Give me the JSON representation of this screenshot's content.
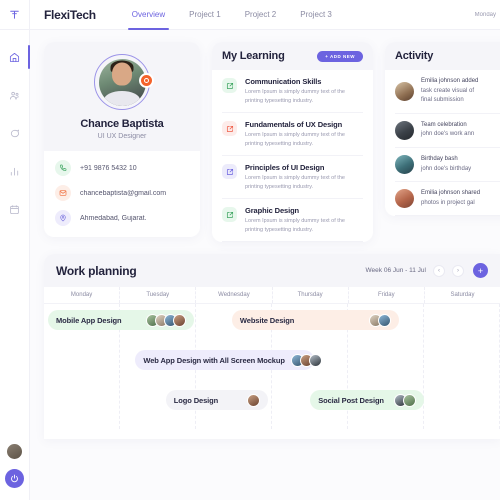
{
  "sidebar": {
    "logo_icon": "flexitech-t-logo-icon",
    "items": [
      {
        "icon": "home-icon",
        "name": "home",
        "active": true
      },
      {
        "icon": "users-icon",
        "name": "team",
        "active": false
      },
      {
        "icon": "chat-icon",
        "name": "messages",
        "active": false
      },
      {
        "icon": "chart-icon",
        "name": "analytics",
        "active": false
      },
      {
        "icon": "calendar-icon",
        "name": "calendar",
        "active": false
      }
    ],
    "bottom": {
      "avatar": "user-avatar",
      "power_icon": "power-icon"
    }
  },
  "header": {
    "brand": "FlexiTech",
    "tabs": [
      {
        "label": "Overview",
        "active": true
      },
      {
        "label": "Project 1",
        "active": false
      },
      {
        "label": "Project 2",
        "active": false
      },
      {
        "label": "Project 3",
        "active": false
      }
    ],
    "date_text": "Monday"
  },
  "profile": {
    "name": "Chance Baptista",
    "role": "UI UX Designer",
    "badge_icon": "verified-badge-icon",
    "rows": [
      {
        "icon": "phone-icon",
        "color": "green",
        "value": "+91 9876 5432 10"
      },
      {
        "icon": "mail-icon",
        "color": "orange",
        "value": "chancebaptista@gmail.com"
      },
      {
        "icon": "location-icon",
        "color": "purple",
        "value": "Ahmedabad, Gujarat."
      }
    ]
  },
  "learning": {
    "title": "My Learning",
    "add_button": "+ ADD NEW",
    "items": [
      {
        "name": "Communication Skills",
        "desc": "Lorem Ipsum is simply dummy text of the printing typesetting industry.",
        "color": "green"
      },
      {
        "name": "Fundamentals of UX Design",
        "desc": "Lorem Ipsum is simply dummy text of the printing typesetting industry.",
        "color": "red"
      },
      {
        "name": "Principles of UI Design",
        "desc": "Lorem Ipsum is simply dummy text of the printing typesetting industry.",
        "color": "purple"
      },
      {
        "name": "Graphic Design",
        "desc": "Lorem Ipsum is simply dummy text of the printing typesetting industry.",
        "color": "green"
      }
    ]
  },
  "activity": {
    "title": "Activity",
    "items": [
      {
        "line1": "Emilia johnson added",
        "line2": "task create visual of",
        "line3": "final submission"
      },
      {
        "line1": "Team celebration",
        "line2": "john doe's work ann",
        "line3": ""
      },
      {
        "line1": "Birthday bash",
        "line2": "john doe's birthday",
        "line3": ""
      },
      {
        "line1": "Emilia johnson shared",
        "line2": "photos in project gal",
        "line3": ""
      }
    ]
  },
  "planning": {
    "title": "Work planning",
    "week_label": "Week 06 Jun - 11 Jul",
    "prev_icon": "chevron-left-icon",
    "next_icon": "chevron-right-icon",
    "add_icon": "plus-icon",
    "days": [
      "Monday",
      "Tuesday",
      "Wednesday",
      "Thursday",
      "Friday",
      "Saturday"
    ],
    "tasks": [
      {
        "label": "Mobile App Design",
        "color": "#e5f7e8",
        "avatars": 4,
        "row": 0,
        "start": 0.0,
        "span": 2.02
      },
      {
        "label": "Website Design",
        "color": "#fdeee6",
        "avatars": 2,
        "row": 0,
        "start": 2.42,
        "span": 2.3
      },
      {
        "label": "Web App Design with All Screen Mockup",
        "color": "#eeecfc",
        "avatars": 3,
        "row": 1,
        "start": 1.15,
        "span": 2.45
      },
      {
        "label": "Logo Design",
        "color": "#f3f3f7",
        "avatars": 1,
        "row": 2,
        "start": 1.55,
        "span": 1.45
      },
      {
        "label": "Social Post Design",
        "color": "#e5f7e8",
        "avatars": 2,
        "row": 2,
        "start": 3.45,
        "span": 1.6
      }
    ]
  },
  "colors": {
    "accent": "#6c63e0",
    "green": "#3aa35e",
    "orange": "#ef6c3a",
    "badge": "#f4622b"
  }
}
